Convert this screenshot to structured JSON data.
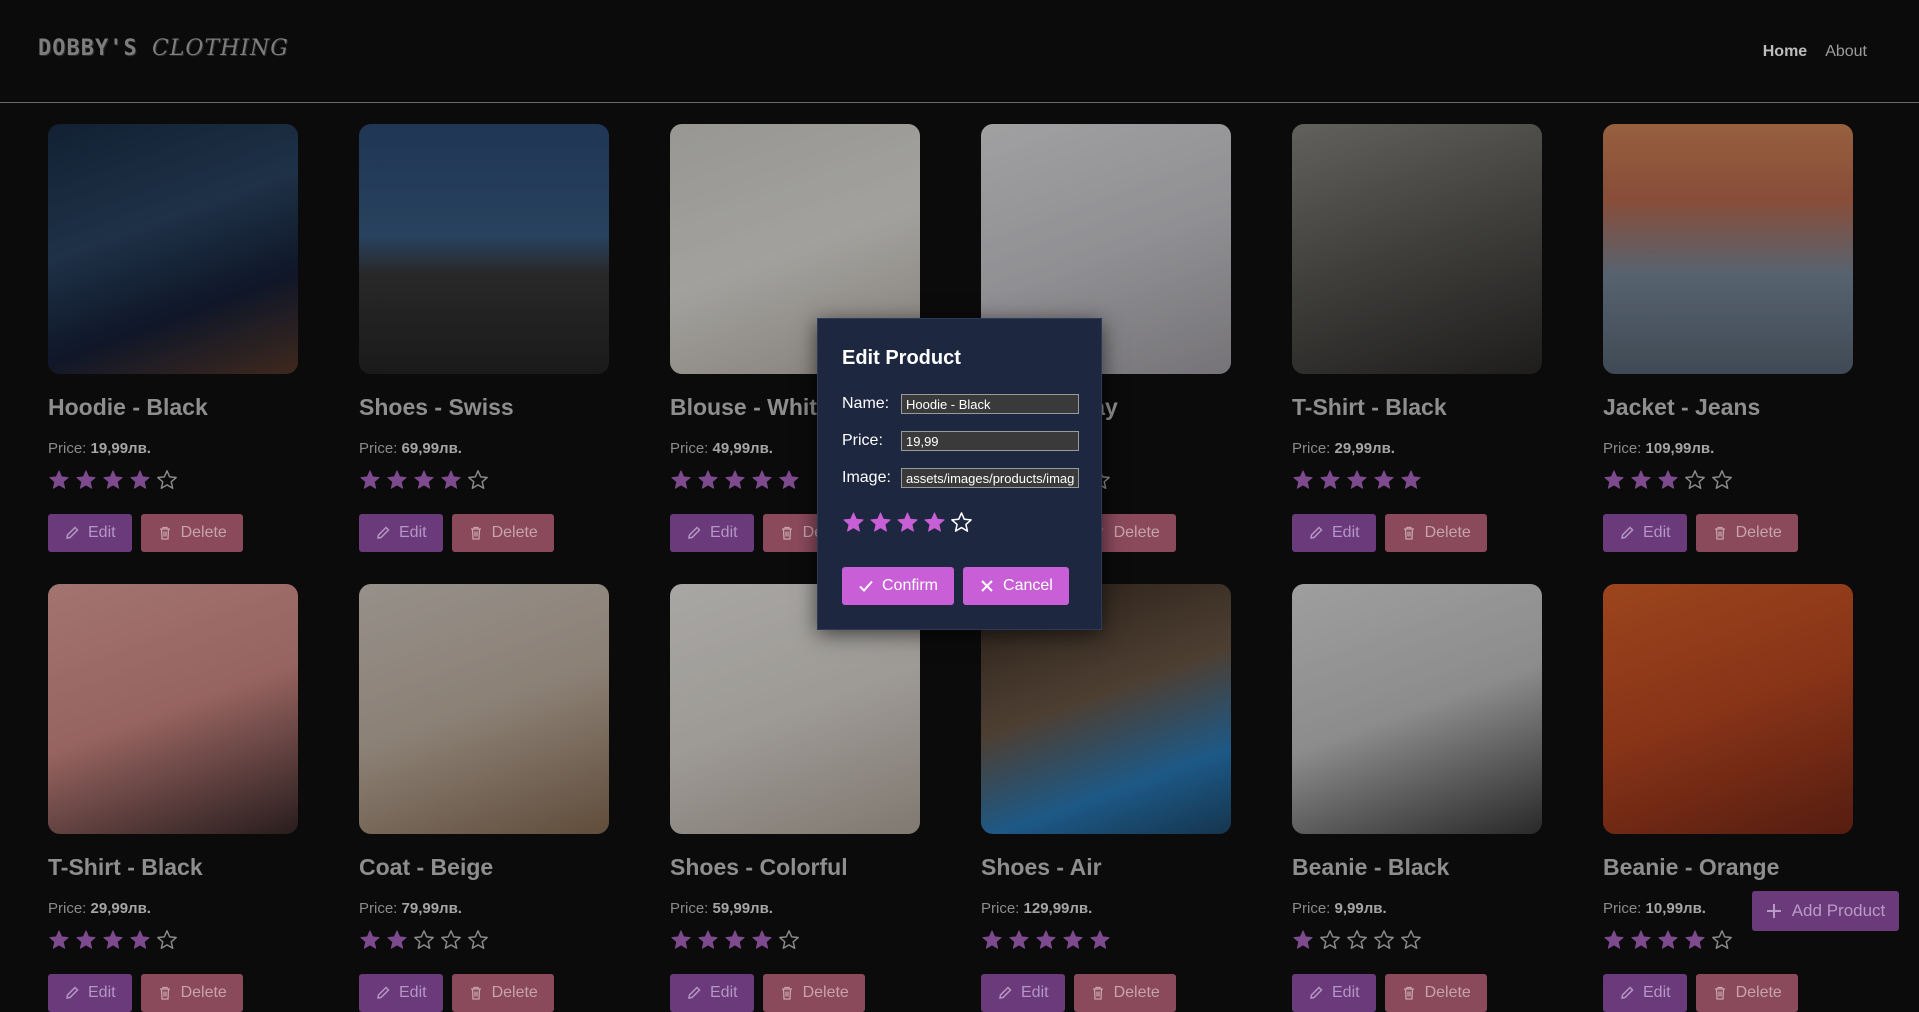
{
  "brand": {
    "logo_part1": "DOBBY'S",
    "logo_part2": "CLOTHING"
  },
  "nav": {
    "home": "Home",
    "about": "About"
  },
  "labels": {
    "price": "Price:",
    "edit": "Edit",
    "delete": "Delete"
  },
  "colors": {
    "accent": "#c85fd6",
    "modal_bg": "#1d2740",
    "page_bg": "#0b0b0c"
  },
  "products": [
    {
      "name": "Hoodie - Black",
      "price": "19,99лв.",
      "rating": 4
    },
    {
      "name": "Shoes - Swiss",
      "price": "69,99лв.",
      "rating": 4
    },
    {
      "name": "Blouse - White",
      "price": "49,99лв.",
      "rating": 5
    },
    {
      "name": "Dress - Gray",
      "price": "",
      "rating": 0
    },
    {
      "name": "T-Shirt - Black",
      "price": "29,99лв.",
      "rating": 5
    },
    {
      "name": "Jacket - Jeans",
      "price": "109,99лв.",
      "rating": 3
    },
    {
      "name": "T-Shirt - Black",
      "price": "29,99лв.",
      "rating": 4
    },
    {
      "name": "Coat - Beige",
      "price": "79,99лв.",
      "rating": 2
    },
    {
      "name": "Shoes - Colorful",
      "price": "59,99лв.",
      "rating": 4
    },
    {
      "name": "Shoes - Air",
      "price": "129,99лв.",
      "rating": 5
    },
    {
      "name": "Beanie - Black",
      "price": "9,99лв.",
      "rating": 1
    },
    {
      "name": "Beanie - Orange",
      "price": "10,99лв.",
      "rating": 4
    }
  ],
  "modal": {
    "title": "Edit Product",
    "name_label": "Name:",
    "price_label": "Price:",
    "image_label": "Image:",
    "name_value": "Hoodie - Black",
    "price_value": "19,99",
    "image_value": "assets/images/products/imag",
    "rating": 4,
    "confirm_label": "Confirm",
    "cancel_label": "Cancel"
  },
  "add_button": {
    "label": "Add Product"
  }
}
